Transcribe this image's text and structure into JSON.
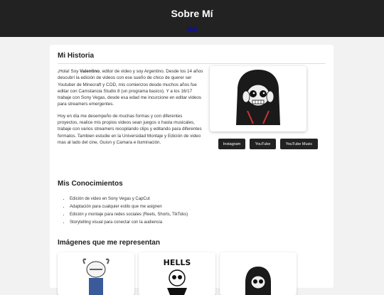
{
  "header": {
    "title": "Sobre Mí",
    "link": "Inicio"
  },
  "historia": {
    "heading": "Mi Historia",
    "p1_pre": "¡Hola! Soy ",
    "p1_name": "Valentino",
    "p1_post": ", editor de video y soy Argentino. Desde los 14 años descubrí la edición de videos con ese sueño de chico de querer ser Youtuber de Minecraft y COD, mis comienzos desde muchos años fue editar con Camstancia Studio 8 (un programa basico). Y a los 16/17 trabaje con Sony Vegas, desde esa edad me incurcione en editar videos para streamers emergentes.",
    "p2": "Hoy en día me desempeño de muchas formas y con diferentes proyectos, realice mis propios videos sean juegos o hasta musicales, trabaje con varios streamers recopilando clips y editando para diferentes formatos. Tambien estudie en la Universidad Montaje y Edición de video mas al lado del cine, Guion y Camara e iluminación."
  },
  "social": {
    "instagram": "Instagram",
    "youtube": "YouTube",
    "youtube_music": "YouTube Music"
  },
  "conocimientos": {
    "heading": "Mis Conocimientos",
    "items": [
      "Edición de video en Sony Vegas y CapCut",
      "Adaptación para cualquier estilo que me asignen",
      "Edición y montaje para redes sociales (Reels, Shorts, TikToks)",
      "Storytelling visual para conectar con la audiencia"
    ]
  },
  "imagenes": {
    "heading": "Imágenes que me representan"
  },
  "colors": {
    "header_bg": "#222222",
    "page_bg": "#f2f2f2",
    "button_bg": "#222222"
  }
}
